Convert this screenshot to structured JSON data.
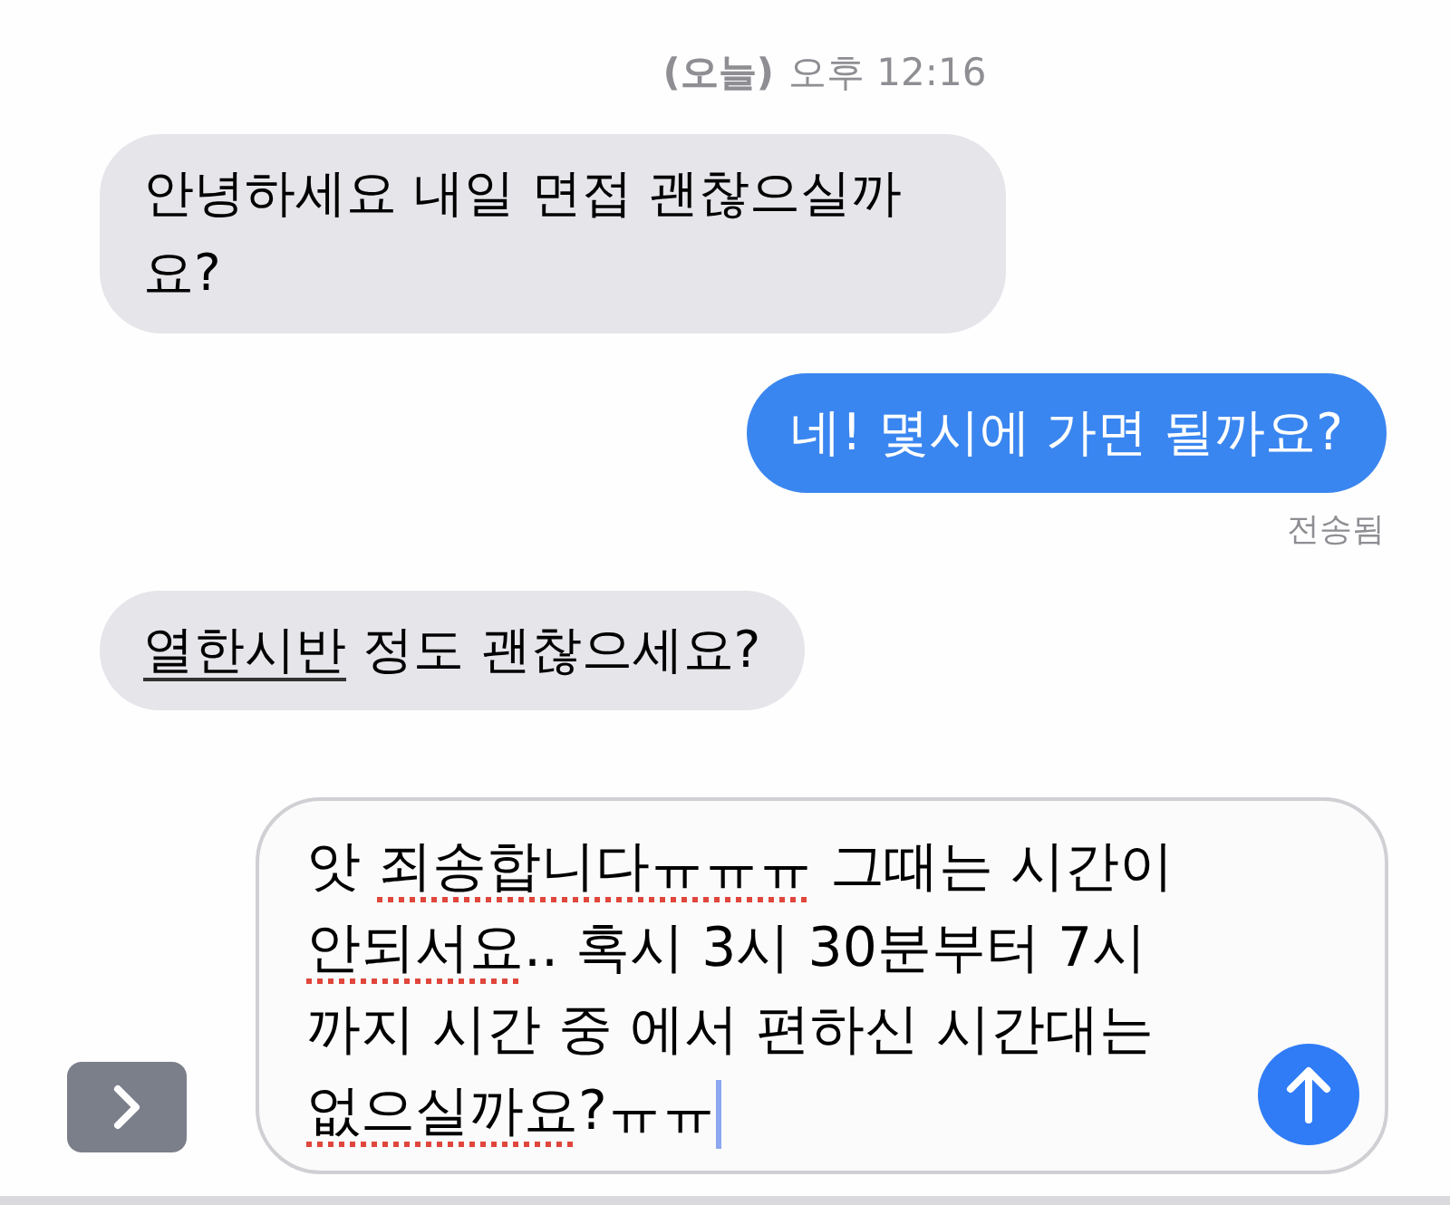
{
  "timestamp": {
    "day": "(오늘)",
    "time": "오후 12:16"
  },
  "messages": [
    {
      "kind": "incoming",
      "segments": [
        {
          "text": "안녕하세요 내일 면접 괜찮으실까요?",
          "kind": "plain"
        }
      ]
    },
    {
      "kind": "outgoing",
      "segments": [
        {
          "text": "네! 몇시에 가면 될까요?",
          "kind": "plain"
        }
      ],
      "status": "전송됨"
    },
    {
      "kind": "incoming",
      "segments": [
        {
          "text": "열한시반",
          "kind": "detected"
        },
        {
          "text": " 정도 괜찮으세요?",
          "kind": "plain"
        }
      ]
    }
  ],
  "composer": {
    "lines": [
      [
        {
          "text": "앗 ",
          "kind": "plain"
        },
        {
          "text": "죄송합니다ㅠㅠㅠ",
          "kind": "misspelled"
        },
        {
          "text": " 그때는 시간이",
          "kind": "plain"
        }
      ],
      [
        {
          "text": "안되서요",
          "kind": "misspelled"
        },
        {
          "text": ".. 혹시 3시 30분부터 7시",
          "kind": "plain"
        }
      ],
      [
        {
          "text": "까지 시간 중 에서 편하신 시간대는",
          "kind": "plain"
        }
      ],
      [
        {
          "text": "없으실까요",
          "kind": "misspelled"
        },
        {
          "text": "?ㅠㅠ",
          "kind": "plain"
        }
      ]
    ],
    "cursor": true
  }
}
